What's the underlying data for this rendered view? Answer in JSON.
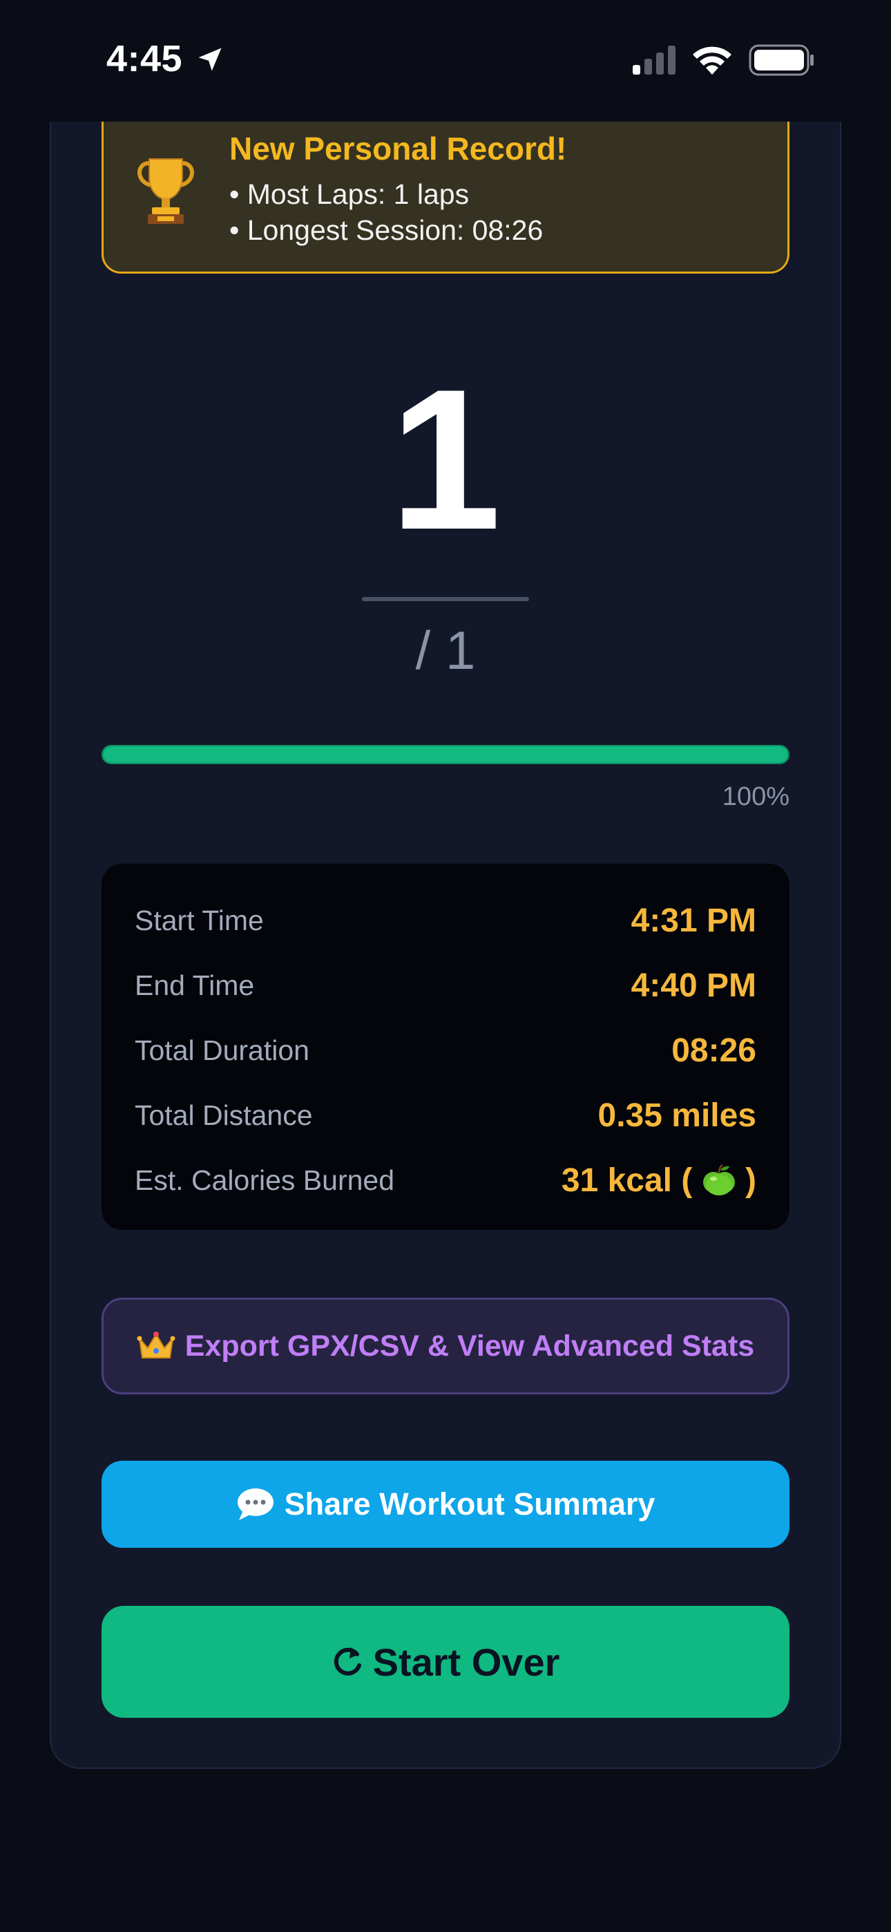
{
  "status_bar": {
    "time": "4:45"
  },
  "record": {
    "title": "New Personal Record!",
    "lines": [
      "• Most Laps: 1 laps",
      "• Longest Session: 08:26"
    ]
  },
  "laps": {
    "completed": "1",
    "total_label": "/ 1"
  },
  "progress": {
    "percent": 100,
    "label": "100%"
  },
  "stats": [
    {
      "label": "Start Time",
      "value": "4:31 PM"
    },
    {
      "label": "End Time",
      "value": "4:40 PM"
    },
    {
      "label": "Total Duration",
      "value": "08:26"
    },
    {
      "label": "Total Distance",
      "value": "0.35 miles"
    },
    {
      "label": "Est. Calories Burned",
      "value_prefix": "31 kcal (",
      "value_suffix": ")"
    }
  ],
  "buttons": {
    "export": "Export GPX/CSV & View Advanced Stats",
    "share": "Share Workout Summary",
    "start_over": "Start Over"
  },
  "colors": {
    "accent_green": "#10b981",
    "accent_blue": "#0ea5e9",
    "record_gold": "#f4b820",
    "stat_value": "#f6b73c",
    "export_purple": "#c07ef6"
  },
  "icons": {
    "location": "location-arrow-icon",
    "trophy": "trophy-icon",
    "apple": "apple-icon",
    "crown": "crown-icon",
    "chat": "speech-bubble-icon",
    "restart": "refresh-icon"
  }
}
